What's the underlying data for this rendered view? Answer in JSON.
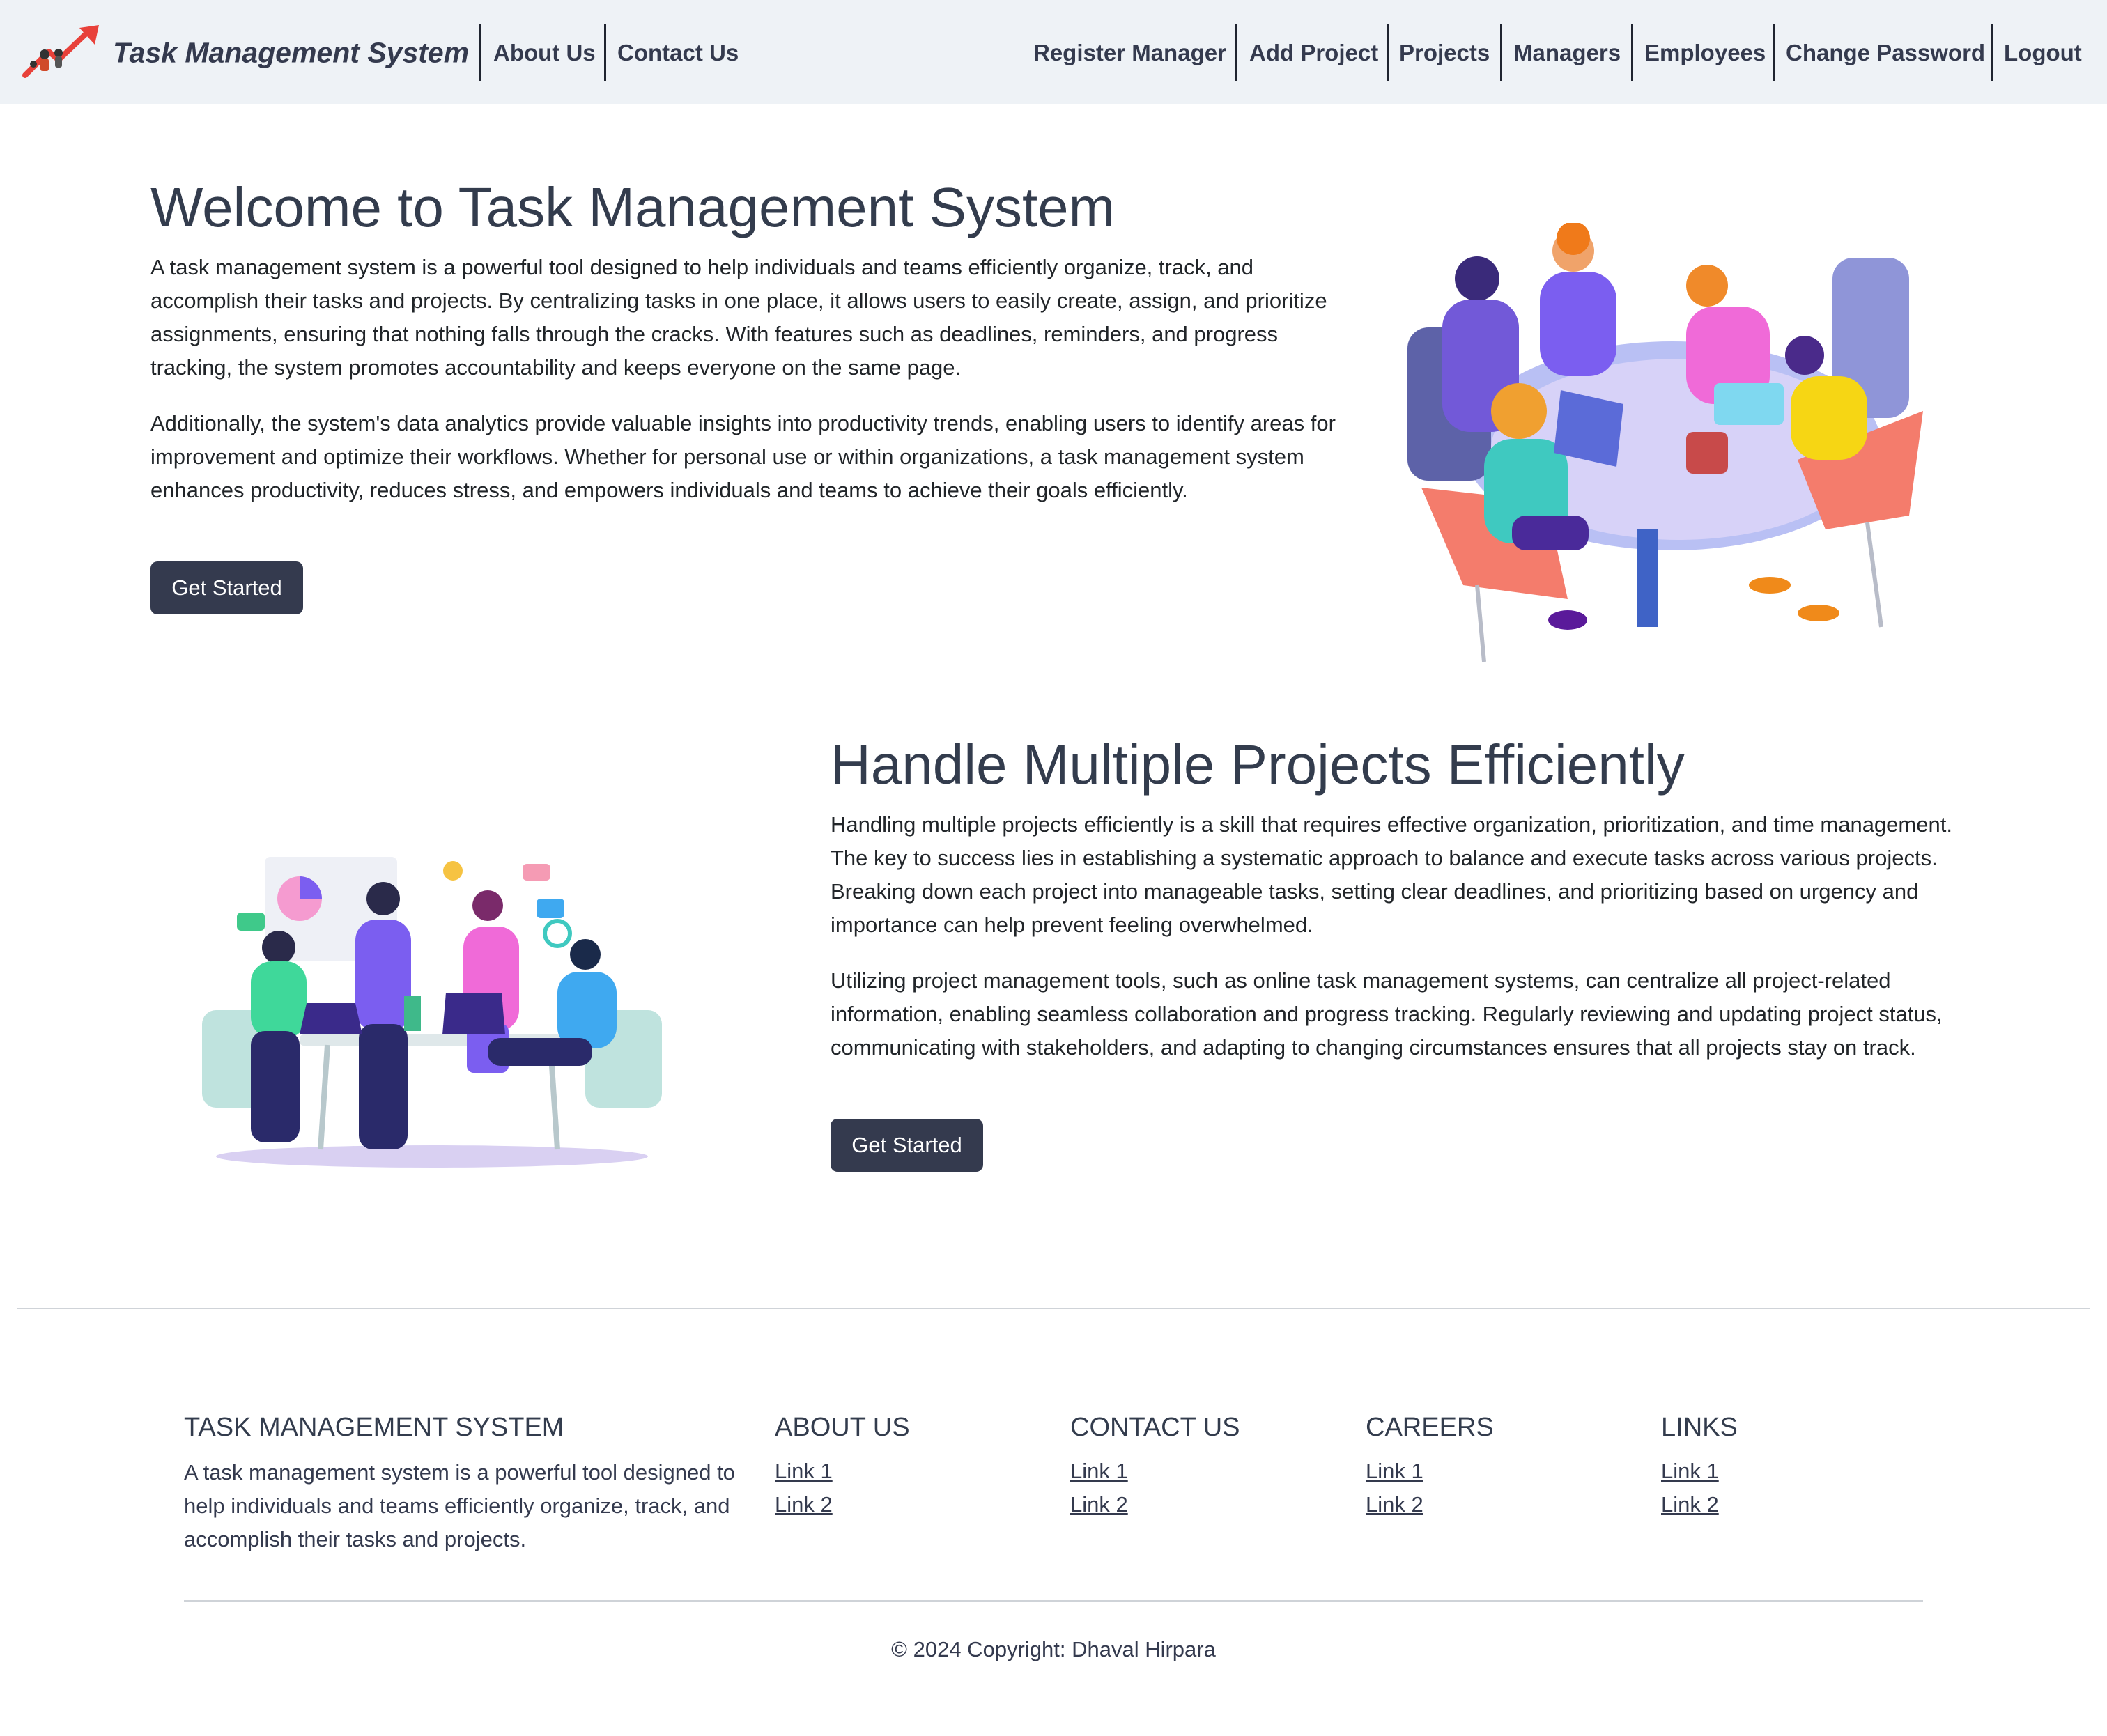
{
  "nav": {
    "brand": "Task Management System",
    "left_links": [
      "About Us",
      "Contact Us"
    ],
    "right_links": [
      "Register Manager",
      "Add Project",
      "Projects",
      "Managers",
      "Employees",
      "Change Password",
      "Logout"
    ]
  },
  "hero": {
    "title": "Welcome to Task Management System",
    "p1": "A task management system is a powerful tool designed to help individuals and teams efficiently organize, track, and accomplish their tasks and projects. By centralizing tasks in one place, it allows users to easily create, assign, and prioritize assignments, ensuring that nothing falls through the cracks. With features such as deadlines, reminders, and progress tracking, the system promotes accountability and keeps everyone on the same page.",
    "p2": "Additionally, the system's data analytics provide valuable insights into productivity trends, enabling users to identify areas for improvement and optimize their workflows. Whether for personal use or within organizations, a task management system enhances productivity, reduces stress, and empowers individuals and teams to achieve their goals efficiently.",
    "button": "Get Started"
  },
  "section2": {
    "title": "Handle Multiple Projects Efficiently",
    "p1": "Handling multiple projects efficiently is a skill that requires effective organization, prioritization, and time management. The key to success lies in establishing a systematic approach to balance and execute tasks across various projects. Breaking down each project into manageable tasks, setting clear deadlines, and prioritizing based on urgency and importance can help prevent feeling overwhelmed.",
    "p2": "Utilizing project management tools, such as online task management systems, can centralize all project-related information, enabling seamless collaboration and progress tracking. Regularly reviewing and updating project status, communicating with stakeholders, and adapting to changing circumstances ensures that all projects stay on track.",
    "button": "Get Started"
  },
  "footer": {
    "about_title": "TASK MANAGEMENT SYSTEM",
    "about_text": "A task management system is a powerful tool designed to help individuals and teams efficiently organize, track, and accomplish their tasks and projects.",
    "columns": [
      {
        "title": "ABOUT US",
        "links": [
          "Link 1",
          "Link 2"
        ]
      },
      {
        "title": "CONTACT US",
        "links": [
          "Link 1",
          "Link 2"
        ]
      },
      {
        "title": "CAREERS",
        "links": [
          "Link 1",
          "Link 2"
        ]
      },
      {
        "title": "LINKS",
        "links": [
          "Link 1",
          "Link 2"
        ]
      }
    ],
    "copyright": "© 2024 Copyright: Dhaval Hirpara"
  },
  "colors": {
    "nav_bg": "#eef2f6",
    "primary": "#343a4e",
    "accent_red": "#e8413a"
  }
}
